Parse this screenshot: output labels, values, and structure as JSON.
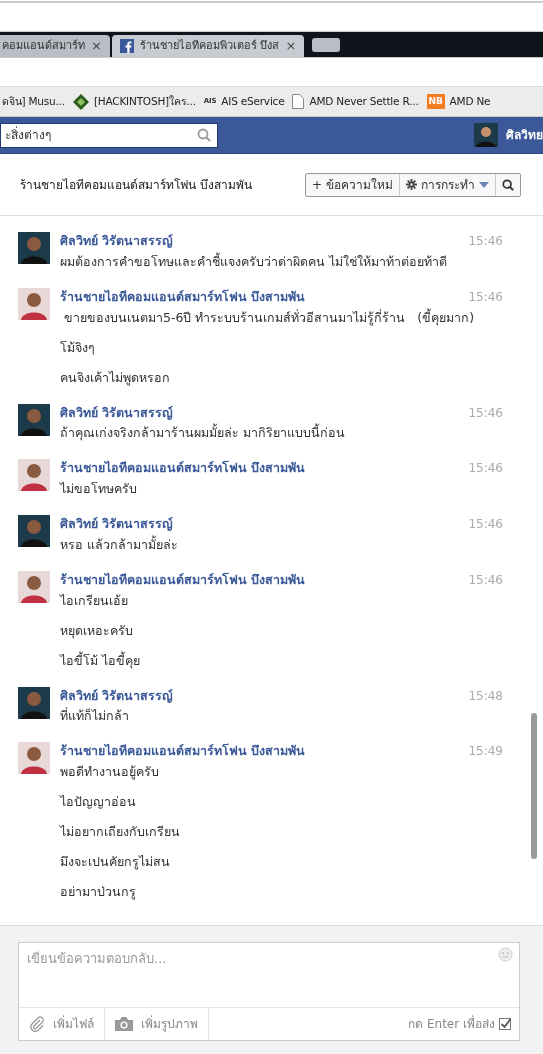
{
  "browser": {
    "tabs": [
      {
        "label": "คอมแอนด์สมาร์ท",
        "kind": "plain",
        "close": "×",
        "selected": false
      },
      {
        "label": "ร้านชายไอทีคอมพิวเตอร์ บึงส",
        "kind": "facebook",
        "close": "×",
        "selected": true
      }
    ],
    "bookmarks": [
      {
        "label": "ดจิน] Musu...",
        "kind": "plain"
      },
      {
        "label": "[HACKINTOSH]ใคร...",
        "kind": "diamond"
      },
      {
        "label": "AIS eService",
        "kind": "ais",
        "icon_text": "AIS"
      },
      {
        "label": "AMD Never Settle R...",
        "kind": "page"
      },
      {
        "label": "AMD Ne",
        "kind": "nb",
        "icon_text": "NB"
      }
    ]
  },
  "topbar": {
    "search_placeholder": "ะสิ่งต่างๆ",
    "user_name": "ศิลวิทย"
  },
  "conversation": {
    "title": "ร้านชายไอทีคอมแอนด์สมาร์ทโฟน บึงสามพัน",
    "new_message_button": "ข้อความใหม่",
    "new_message_plus": "+",
    "actions_button": "การกระทำ"
  },
  "messages": [
    {
      "sender": "ศิลวิทย์ วิรัตนาสรรญ์",
      "kind": "self",
      "time": "15:46",
      "lines": [
        "ผมต้องการคำขอโทษและคำชี้แจงครับว่าด่าผิดคน ไม่ใช่ให้มาท้าต่อยท้าตี"
      ]
    },
    {
      "sender": "ร้านชายไอทีคอมแอนด์สมาร์ทโฟน บึงสามพัน",
      "kind": "shop",
      "time": "15:46",
      "lines": [
        " ขายของบนเนตมา5-6ปี ทำระบบร้านเกมส์ทั่วอีสานมาไม่รู้กี่ร้าน   (ขี้คุยมาก)",
        "โม้จิงๆ",
        "คนจิงเค้าไม่พูดหรอก"
      ]
    },
    {
      "sender": "ศิลวิทย์ วิรัตนาสรรญ์",
      "kind": "self",
      "time": "15:46",
      "lines": [
        "ถ้าคุณเก่งจริงกล้ามาร้านผมมั้ยล่ะ มากิริยาแบบนี้ก่อน"
      ]
    },
    {
      "sender": "ร้านชายไอทีคอมแอนด์สมาร์ทโฟน บึงสามพัน",
      "kind": "shop",
      "time": "15:46",
      "lines": [
        "ไม่ขอโทษครับ"
      ]
    },
    {
      "sender": "ศิลวิทย์ วิรัตนาสรรญ์",
      "kind": "self",
      "time": "15:46",
      "lines": [
        "หรอ แล้วกล้ามามั้ยล่ะ"
      ]
    },
    {
      "sender": "ร้านชายไอทีคอมแอนด์สมาร์ทโฟน บึงสามพัน",
      "kind": "shop",
      "time": "15:46",
      "lines": [
        "ไอเกรียนเอ้ย",
        "หยุดเหอะครับ",
        "ไอขี้โม้ ไอขี้คุย"
      ]
    },
    {
      "sender": "ศิลวิทย์ วิรัตนาสรรญ์",
      "kind": "self",
      "time": "15:48",
      "lines": [
        "ที่แท้ก็ไม่กล้า"
      ]
    },
    {
      "sender": "ร้านชายไอทีคอมแอนด์สมาร์ทโฟน บึงสามพัน",
      "kind": "shop",
      "time": "15:49",
      "lines": [
        "พอดีทำงานอยู้ครับ",
        "ไอปัญญาอ่อน",
        "ไม่อยากเถียงกับเกรียน",
        "มึงจะเปนคัยกรูไม่สน",
        "อย่ามาป่วนกรู"
      ]
    }
  ],
  "composer": {
    "placeholder": "เขียนข้อความตอบกลับ...",
    "attach_file": "เพิ่มไฟล์",
    "add_photo": "เพิ่มรูปภาพ",
    "enter_to_send": "กด Enter เพื่อส่ง",
    "enter_to_send_checked": true
  }
}
